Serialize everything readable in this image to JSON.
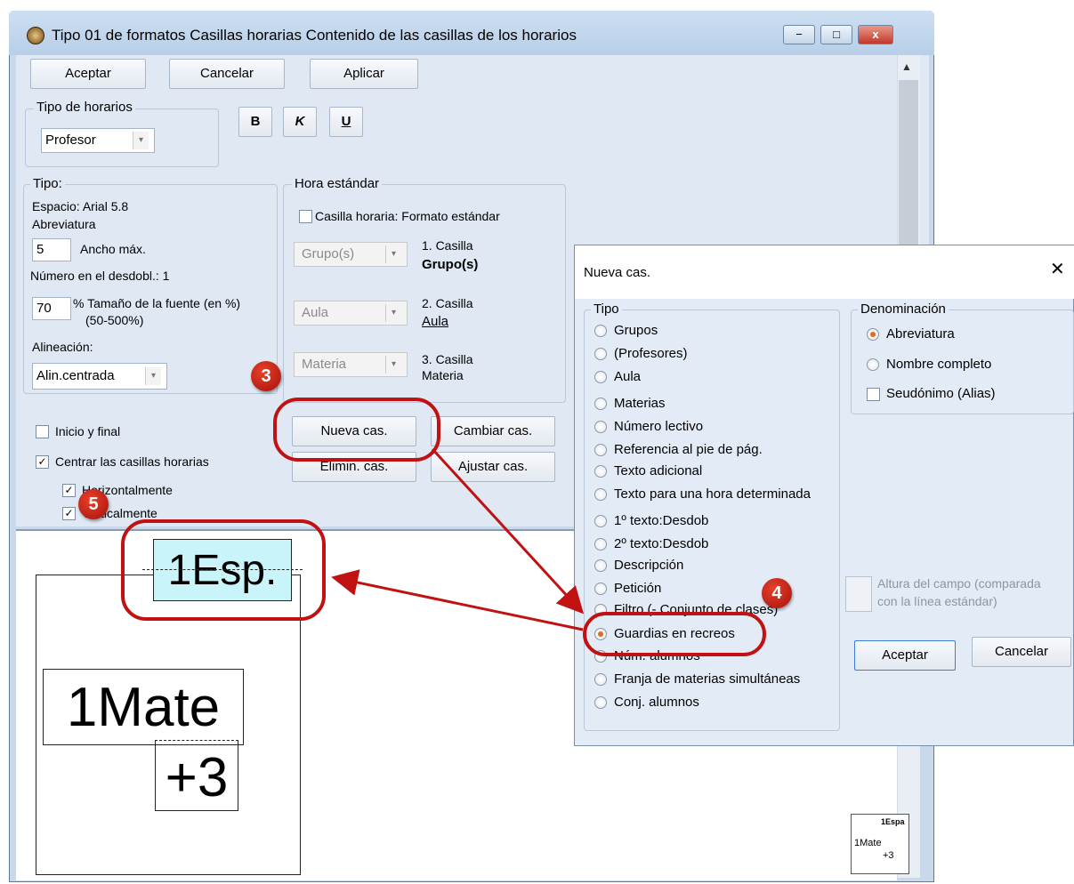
{
  "window": {
    "title": "Tipo 01 de formatos  Casillas horarias  Contenido de las casillas de los horarios",
    "controls": {
      "minimize": "−",
      "maximize": "□",
      "close": "x"
    }
  },
  "toolbar": {
    "accept": "Aceptar",
    "cancel": "Cancelar",
    "apply": "Aplicar"
  },
  "tipo_horarios": {
    "label": "Tipo de horarios",
    "value": "Profesor"
  },
  "format_buttons": {
    "bold": "B",
    "italic": "K",
    "underline": "U"
  },
  "tipo_group": {
    "label": "Tipo:",
    "espacio": "Espacio: Arial 5.8",
    "abreviatura": "Abreviatura",
    "ancho_value": "5",
    "ancho_label": "Ancho máx.",
    "numero_desdobl": "Número en el desdobl.: 1",
    "tamano_value": "70",
    "tamano_label": "% Tamaño de la fuente (en %)",
    "tamano_range": "(50-500%)",
    "alineacion_label": "Alineación:",
    "alineacion_value": "Alin.centrada"
  },
  "hora_estandar": {
    "label": "Hora estándar",
    "checkbox_label": "Casilla horaria: Formato estándar",
    "rows": [
      {
        "combo": "Grupo(s)",
        "num": "1. Casilla",
        "value": "Grupo(s)"
      },
      {
        "combo": "Aula",
        "num": "2. Casilla",
        "value": "Aula"
      },
      {
        "combo": "Materia",
        "num": "3. Casilla",
        "value": "Materia"
      }
    ]
  },
  "actions": {
    "nueva": "Nueva cas.",
    "cambiar": "Cambiar cas.",
    "eliminar": "Elimin. cas.",
    "ajustar": "Ajustar cas."
  },
  "checks": {
    "inicio_final": "Inicio y final",
    "centrar": "Centrar las casillas horarias",
    "horizontal": "Horizontalmente",
    "vertical": "Verticalmente"
  },
  "preview": {
    "box1": "1Esp.",
    "box2": "1Mate",
    "box3": "+3",
    "thumb_top": "1Espa",
    "thumb_mid": "1Mate",
    "thumb_bot": "+3"
  },
  "dialog": {
    "title": "Nueva cas.",
    "close": "✕",
    "tipo_label": "Tipo",
    "tipo_options": [
      "Grupos",
      "(Profesores)",
      "Aula",
      "Materias",
      "Número lectivo",
      "Referencia al pie de pág.",
      "Texto adicional",
      "Texto para una hora determinada",
      "1º texto:Desdob",
      "2º texto:Desdob",
      "Descripción",
      "Petición",
      "Filtro (- Conjunto de clases)",
      "Guardias en recreos",
      "Núm. alumnos",
      "Franja de materias simultáneas",
      "Conj. alumnos"
    ],
    "tipo_selected": "Guardias en recreos",
    "denominacion_label": "Denominación",
    "den_abreviatura": "Abreviatura",
    "den_nombre": "Nombre completo",
    "den_seudonimo": "Seudónimo (Alias)",
    "altura_line1": "Altura del campo (comparada",
    "altura_line2": "con la línea estándar)",
    "accept": "Aceptar",
    "cancel": "Cancelar"
  },
  "badges": {
    "b3": "3",
    "b4": "4",
    "b5": "5"
  },
  "colors": {
    "callout": "#c01212",
    "highlight": "#c8f4fa",
    "window_bg": "#dfe8f3"
  }
}
